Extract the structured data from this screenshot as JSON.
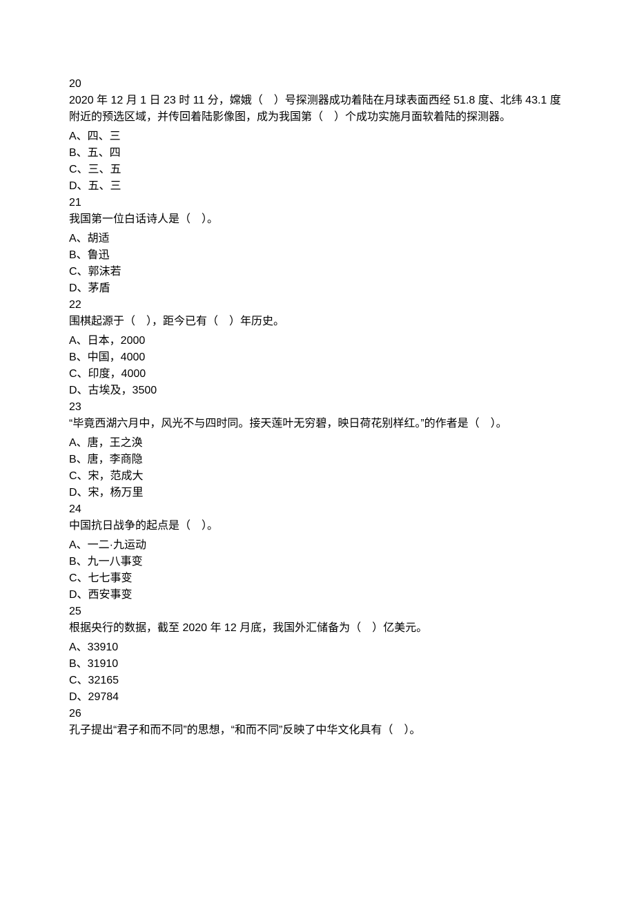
{
  "questions": [
    {
      "number": "20",
      "stem": "2020 年 12 月 1 日 23 时 11 分，嫦娥（　）号探测器成功着陆在月球表面西经 51.8 度、北纬 43.1 度附近的预选区域，并传回着陆影像图，成为我国第（　）个成功实施月面软着陆的探测器。",
      "options": [
        "A、四、三",
        "B、五、四",
        "C、三、五",
        "D、五、三"
      ]
    },
    {
      "number": "21",
      "stem": "我国第一位白话诗人是（　）。",
      "options": [
        "A、胡适",
        "B、鲁迅",
        "C、郭沫若",
        "D、茅盾"
      ]
    },
    {
      "number": "22",
      "stem": "围棋起源于（　），距今已有（　）年历史。",
      "options": [
        "A、日本，2000",
        "B、中国，4000",
        "C、印度，4000",
        "D、古埃及，3500"
      ]
    },
    {
      "number": "23",
      "stem": "“毕竟西湖六月中，风光不与四时同。接天莲叶无穷碧，映日荷花别样红。”的作者是（　）。",
      "options": [
        "A、唐，王之涣",
        "B、唐，李商隐",
        "C、宋，范成大",
        "D、宋，杨万里"
      ]
    },
    {
      "number": "24",
      "stem": "中国抗日战争的起点是（　）。",
      "options": [
        "A、一二·九运动",
        "B、九一八事变",
        "C、七七事变",
        "D、西安事变"
      ]
    },
    {
      "number": "25",
      "stem": "根据央行的数据，截至 2020 年 12 月底，我国外汇储备为（　）亿美元。",
      "options": [
        "A、33910",
        "B、31910",
        "C、32165",
        "D、29784"
      ]
    },
    {
      "number": "26",
      "stem": "孔子提出“君子和而不同”的思想，“和而不同”反映了中华文化具有（　）。",
      "options": []
    }
  ]
}
